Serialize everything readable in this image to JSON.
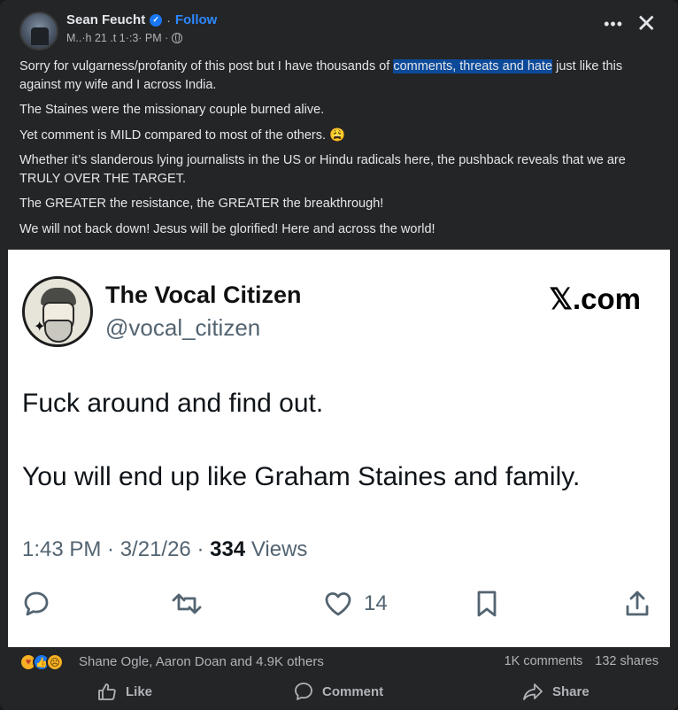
{
  "post": {
    "author": "Sean Feucht",
    "follow_label": "Follow",
    "dot_sep": "·",
    "timestamp": "M..·h 21 .t 1·:3· PM ·"
  },
  "body": {
    "p1_before": "Sorry for vulgarness/profanity of this post but I have thousands of ",
    "p1_highlight": "comments, threats and hate",
    "p1_after": " just like this against my wife and I across India.",
    "p2": "The Staines were the missionary couple burned alive.",
    "p3": "Yet comment is MILD compared to most of the others. 😩",
    "p4": "Whether it’s slanderous lying journalists in the US or Hindu radicals here, the pushback reveals that we are TRULY OVER THE TARGET.",
    "p5": "The GREATER the resistance, the GREATER the breakthrough!",
    "p6": "We will not back down! Jesus will be glorified! Here and across the world!"
  },
  "tweet": {
    "display_name": "The Vocal Citizen",
    "handle": "@vocal_citizen",
    "brand": "𝕏.com",
    "line1": "Fuck around and find out.",
    "line2": "You will end up like Graham Staines and family.",
    "time": "1:43 PM · 3/21/26 · ",
    "views_count": "334",
    "views_label": " Views",
    "likes": "14"
  },
  "reactions": {
    "names": "Shane Ogle, Aaron Doan and 4.9K others",
    "comments": "1K comments",
    "shares": "132 shares"
  },
  "actions": {
    "like": "Like",
    "comment": "Comment",
    "share": "Share"
  }
}
